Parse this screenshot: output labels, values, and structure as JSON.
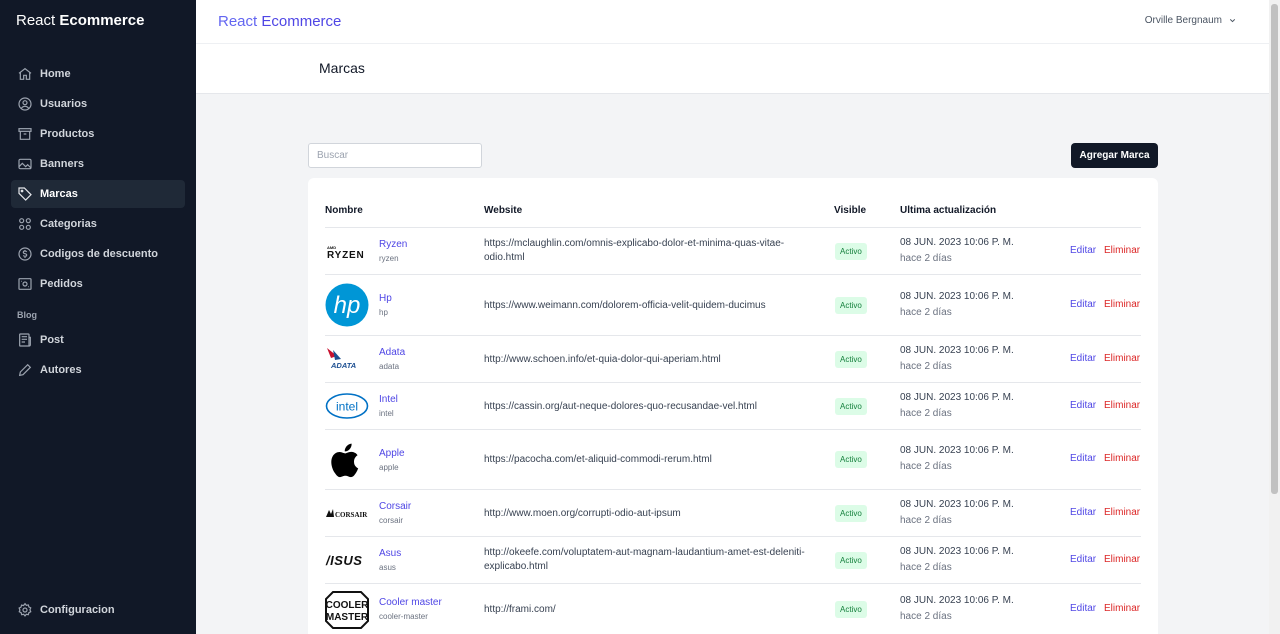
{
  "app": {
    "brand_prefix": "React",
    "brand_name": "Ecommerce"
  },
  "sidebar": {
    "items": [
      {
        "label": "Home",
        "icon": "home-icon"
      },
      {
        "label": "Usuarios",
        "icon": "user-circle-icon"
      },
      {
        "label": "Productos",
        "icon": "archive-icon"
      },
      {
        "label": "Banners",
        "icon": "image-icon"
      },
      {
        "label": "Marcas",
        "icon": "tag-icon",
        "active": true
      },
      {
        "label": "Categorias",
        "icon": "grid-icon"
      },
      {
        "label": "Codigos de descuento",
        "icon": "dollar-circle-icon"
      },
      {
        "label": "Pedidos",
        "icon": "receipt-icon"
      }
    ],
    "blog_section": "Blog",
    "blog_items": [
      {
        "label": "Post",
        "icon": "newspaper-icon"
      },
      {
        "label": "Autores",
        "icon": "pencil-icon"
      }
    ],
    "bottom_item": {
      "label": "Configuracion",
      "icon": "gear-icon"
    }
  },
  "topbar": {
    "user_name": "Orville Bergnaum"
  },
  "page": {
    "title": "Marcas"
  },
  "toolbar": {
    "search_placeholder": "Buscar",
    "add_label": "Agregar Marca"
  },
  "table": {
    "columns": {
      "name": "Nombre",
      "website": "Website",
      "visible": "Visible",
      "updated": "Ultima actualización"
    },
    "edit_label": "Editar",
    "delete_label": "Eliminar",
    "rows": [
      {
        "name": "Ryzen",
        "slug": "ryzen",
        "website": "https://mclaughlin.com/omnis-explicabo-dolor-et-minima-quas-vitae-odio.html",
        "status": "Activo",
        "date": "08 JUN. 2023 10:06 P. M.",
        "ago": "hace 2 días",
        "logo": "ryzen-logo",
        "logo_text": "RYZEN",
        "logo_subtext": "AMD"
      },
      {
        "name": "Hp",
        "slug": "hp",
        "website": "https://www.weimann.com/dolorem-officia-velit-quidem-ducimus",
        "status": "Activo",
        "date": "08 JUN. 2023 10:06 P. M.",
        "ago": "hace 2 días",
        "logo": "hp-logo",
        "logo_text": "hp"
      },
      {
        "name": "Adata",
        "slug": "adata",
        "website": "http://www.schoen.info/et-quia-dolor-qui-aperiam.html",
        "status": "Activo",
        "date": "08 JUN. 2023 10:06 P. M.",
        "ago": "hace 2 días",
        "logo": "adata-logo",
        "logo_text": "ADATA"
      },
      {
        "name": "Intel",
        "slug": "intel",
        "website": "https://cassin.org/aut-neque-dolores-quo-recusandae-vel.html",
        "status": "Activo",
        "date": "08 JUN. 2023 10:06 P. M.",
        "ago": "hace 2 días",
        "logo": "intel-logo",
        "logo_text": "intel"
      },
      {
        "name": "Apple",
        "slug": "apple",
        "website": "https://pacocha.com/et-aliquid-commodi-rerum.html",
        "status": "Activo",
        "date": "08 JUN. 2023 10:06 P. M.",
        "ago": "hace 2 días",
        "logo": "apple-logo"
      },
      {
        "name": "Corsair",
        "slug": "corsair",
        "website": "http://www.moen.org/corrupti-odio-aut-ipsum",
        "status": "Activo",
        "date": "08 JUN. 2023 10:06 P. M.",
        "ago": "hace 2 días",
        "logo": "corsair-logo",
        "logo_text": "CORSAIR"
      },
      {
        "name": "Asus",
        "slug": "asus",
        "website": "http://okeefe.com/voluptatem-aut-magnam-laudantium-amet-est-deleniti-explicabo.html",
        "status": "Activo",
        "date": "08 JUN. 2023 10:06 P. M.",
        "ago": "hace 2 días",
        "logo": "asus-logo",
        "logo_text": "/ISUS"
      },
      {
        "name": "Cooler master",
        "slug": "cooler-master",
        "website": "http://frami.com/",
        "status": "Activo",
        "date": "08 JUN. 2023 10:06 P. M.",
        "ago": "hace 2 días",
        "logo": "cooler-master-logo",
        "logo_text": "COOLER",
        "logo_subtext": "MASTER"
      }
    ]
  }
}
